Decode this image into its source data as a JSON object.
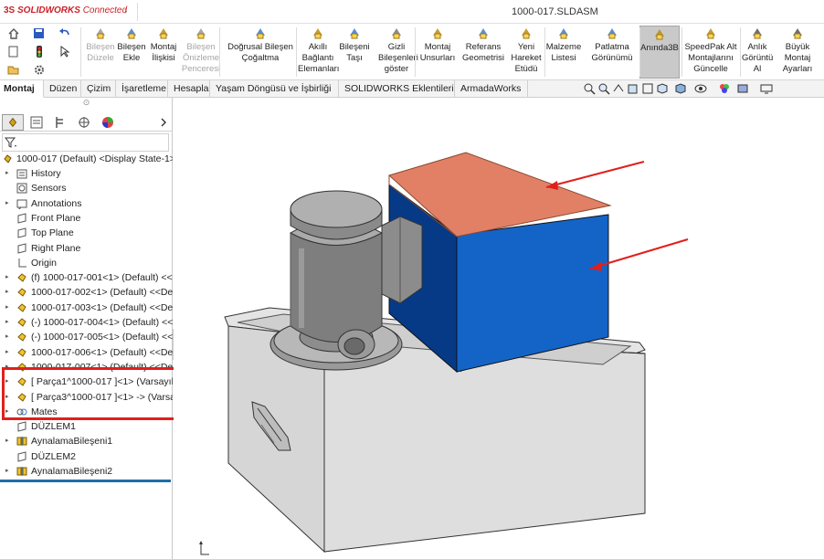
{
  "titlebar": {
    "logo_ds": "3S",
    "logo_brand": "SOLIDWORKS",
    "logo_connected": "Connected",
    "document_title": "1000-017.SLDASM"
  },
  "ribbon": {
    "buttons": [
      {
        "label": "Bileşen\nDüzele",
        "disabled": true
      },
      {
        "label": "Bileşen\nEkle",
        "disabled": false
      },
      {
        "label": "Montaj\nİlişkisi",
        "disabled": false
      },
      {
        "label": "Bileşen\nÖnizleme\nPenceresi",
        "disabled": true
      },
      {
        "label": "Doğrusal Bileşen\nÇoğaltma",
        "disabled": false
      },
      {
        "label": "Akıllı\nBağlantı\nElemanları",
        "disabled": false
      },
      {
        "label": "Bileşeni\nTaşı",
        "disabled": false
      },
      {
        "label": "Gizli\nBileşenleri\ngöster",
        "disabled": false
      },
      {
        "label": "Montaj\nUnsurları",
        "disabled": false
      },
      {
        "label": "Referans\nGeometrisi",
        "disabled": false
      },
      {
        "label": "Yeni\nHareket\nEtüdü",
        "disabled": false
      },
      {
        "label": "Malzeme\nListesi",
        "disabled": false
      },
      {
        "label": "Patlatma\nGörünümü",
        "disabled": false
      },
      {
        "label": "Anında3B",
        "disabled": false,
        "active": true
      },
      {
        "label": "SpeedPak Alt\nMontajlarını\nGüncelle",
        "disabled": false
      },
      {
        "label": "Anlık\nGörüntü\nAl",
        "disabled": false
      },
      {
        "label": "Büyük\nMontaj\nAyarları",
        "disabled": false
      }
    ]
  },
  "tabs": [
    {
      "label": "Montaj",
      "selected": true
    },
    {
      "label": "Düzen"
    },
    {
      "label": "Çizim"
    },
    {
      "label": "İşaretleme"
    },
    {
      "label": "Hesapla"
    },
    {
      "label": "Yaşam Döngüsü ve İşbirliği"
    },
    {
      "label": "SOLIDWORKS Eklentileri"
    },
    {
      "label": "ArmadaWorks"
    }
  ],
  "tree": {
    "root": "1000-017 (Default) <Display State-1>",
    "items": [
      {
        "label": "History",
        "icon": "history-icon",
        "twisty": true
      },
      {
        "label": "Sensors",
        "icon": "sensor-icon",
        "twisty": false
      },
      {
        "label": "Annotations",
        "icon": "annotation-icon",
        "twisty": true
      },
      {
        "label": "Front Plane",
        "icon": "plane-icon",
        "twisty": false
      },
      {
        "label": "Top Plane",
        "icon": "plane-icon",
        "twisty": false
      },
      {
        "label": "Right Plane",
        "icon": "plane-icon",
        "twisty": false
      },
      {
        "label": "Origin",
        "icon": "origin-icon",
        "twisty": false
      },
      {
        "label": "(f) 1000-017-001<1> (Default) <<De",
        "icon": "part-icon",
        "twisty": true
      },
      {
        "label": "1000-017-002<1> (Default) <<De",
        "icon": "part-icon",
        "twisty": true
      },
      {
        "label": "1000-017-003<1> (Default) <<De",
        "icon": "part-icon",
        "twisty": true
      },
      {
        "label": "(-) 1000-017-004<1> (Default) <<",
        "icon": "part-icon",
        "twisty": true
      },
      {
        "label": "(-) 1000-017-005<1> (Default) <<",
        "icon": "part-icon",
        "twisty": true
      },
      {
        "label": "1000-017-006<1> (Default) <<De",
        "icon": "part-icon",
        "twisty": true
      },
      {
        "label": "1000-017-007<1> (Default) <<De",
        "icon": "part-icon",
        "twisty": true
      },
      {
        "label": "[ Parça1^1000-017 ]<1> (Varsayıla",
        "icon": "part-icon",
        "twisty": true
      },
      {
        "label": "[ Parça3^1000-017 ]<1> -> (Varsa",
        "icon": "part-icon",
        "twisty": true
      },
      {
        "label": "Mates",
        "icon": "mates-icon",
        "twisty": true
      },
      {
        "label": "DÜZLEM1",
        "icon": "plane-icon",
        "twisty": false
      },
      {
        "label": "AynalamaBileşeni1",
        "icon": "mirror-icon",
        "twisty": true
      },
      {
        "label": "DÜZLEM2",
        "icon": "plane-icon",
        "twisty": false
      },
      {
        "label": "AynalamaBileşeni2",
        "icon": "mirror-icon",
        "twisty": true
      }
    ]
  },
  "colors": {
    "accent_red": "#e0201c",
    "lid_top": "#e28066",
    "blue_box": "#1464c8",
    "rollback": "#1f6ea6"
  }
}
